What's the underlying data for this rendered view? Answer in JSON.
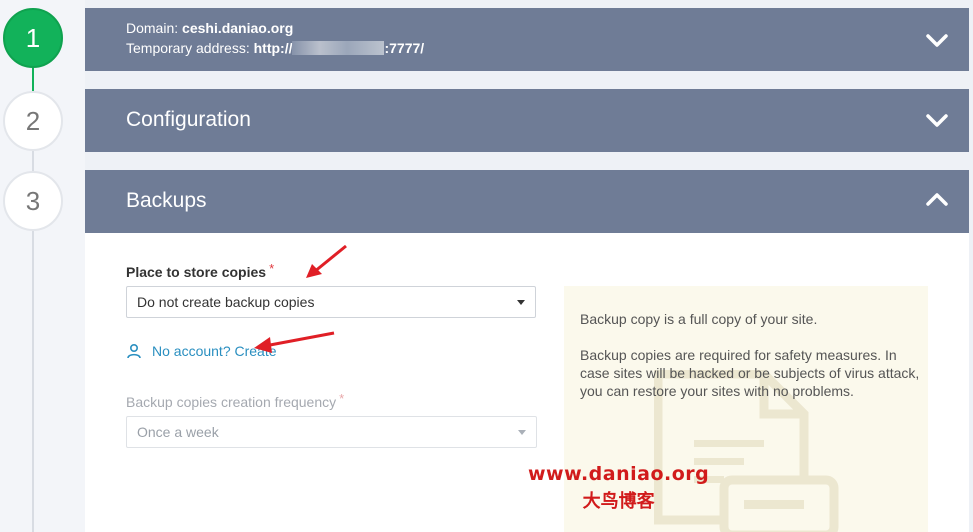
{
  "steps": [
    "1",
    "2",
    "3"
  ],
  "domain_panel": {
    "domain_label": "Domain:",
    "domain_value": "ceshi.daniao.org",
    "temp_label": "Temporary address:",
    "temp_prefix": "http://",
    "temp_suffix": ":7777/"
  },
  "configuration": {
    "title": "Configuration"
  },
  "backups": {
    "title": "Backups",
    "store_label": "Place to store copies",
    "required_mark": "*",
    "store_value": "Do not create backup copies",
    "account_link": "No account? Create",
    "frequency_label": "Backup copies creation frequency",
    "frequency_value": "Once a week",
    "info_1": "Backup copy is a full copy of your site.",
    "info_2": "Backup copies are required for safety measures. In case sites will be hacked or be subjects of virus attack, you can restore your sites with no problems."
  },
  "watermark": {
    "url": "www.daniao.org",
    "name": "大鸟博客"
  },
  "colors": {
    "panel": "#6f7c96",
    "active_step": "#12b25a",
    "link": "#2a8fc0",
    "required": "#e0393e",
    "arrow": "#e01f26"
  }
}
